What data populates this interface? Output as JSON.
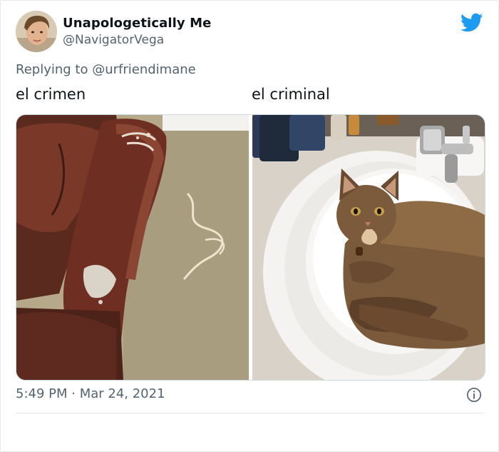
{
  "author": {
    "display_name": "Unapologetically Me",
    "handle": "@NavigatorVega"
  },
  "reply": {
    "prefix": "Replying to ",
    "mention": "@urfriendimane"
  },
  "captions": {
    "left": "el crimen",
    "right": "el criminal"
  },
  "media": [
    {
      "subject": "damaged leather armchair",
      "icon": "photo"
    },
    {
      "subject": "cat in sink",
      "icon": "photo"
    }
  ],
  "timestamp": "5:49 PM · Mar 24, 2021",
  "icons": {
    "brand": "twitter-bird-icon",
    "info": "info-icon"
  },
  "colors": {
    "brand": "#1d9bf0",
    "secondary_text": "#536471"
  }
}
